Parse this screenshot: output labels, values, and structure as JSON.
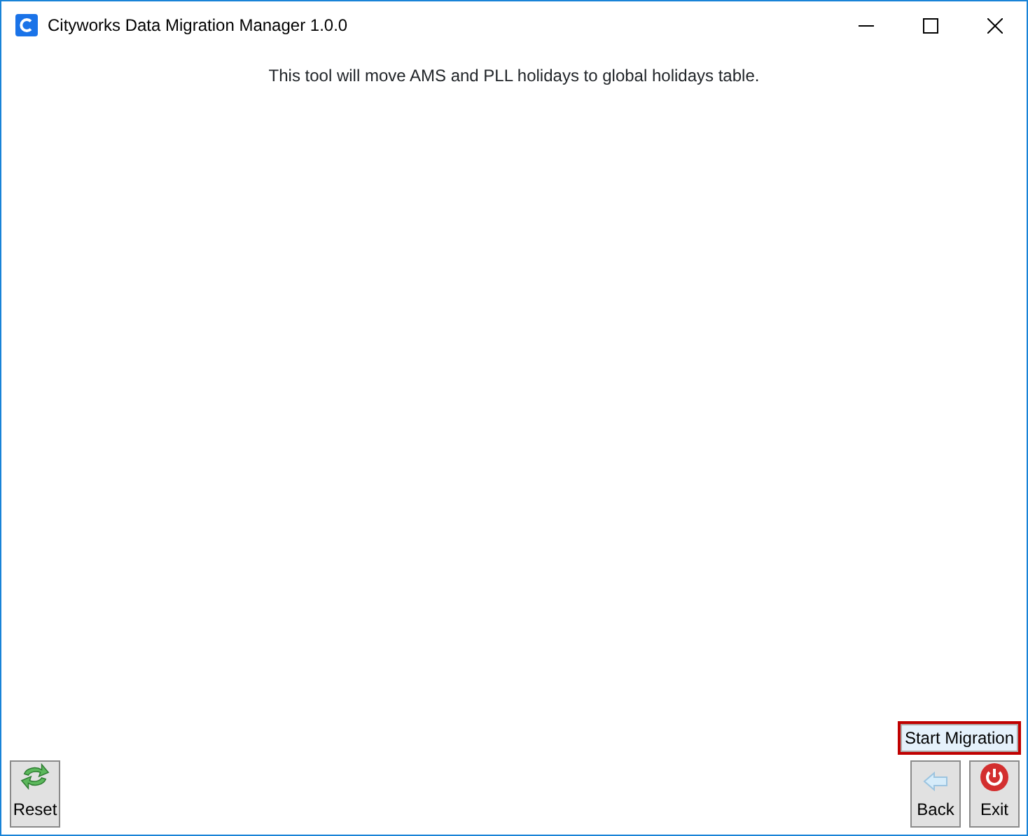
{
  "window": {
    "title": "Cityworks Data Migration Manager 1.0.0"
  },
  "message": "This tool will move AMS and PLL holidays to global holidays table.",
  "start_button": {
    "label": "Start Migration",
    "focused": true
  },
  "buttons": [
    {
      "kind": "reset",
      "label": "Reset"
    },
    {
      "kind": "back",
      "label": "Back"
    },
    {
      "kind": "exit",
      "label": "Exit"
    }
  ]
}
